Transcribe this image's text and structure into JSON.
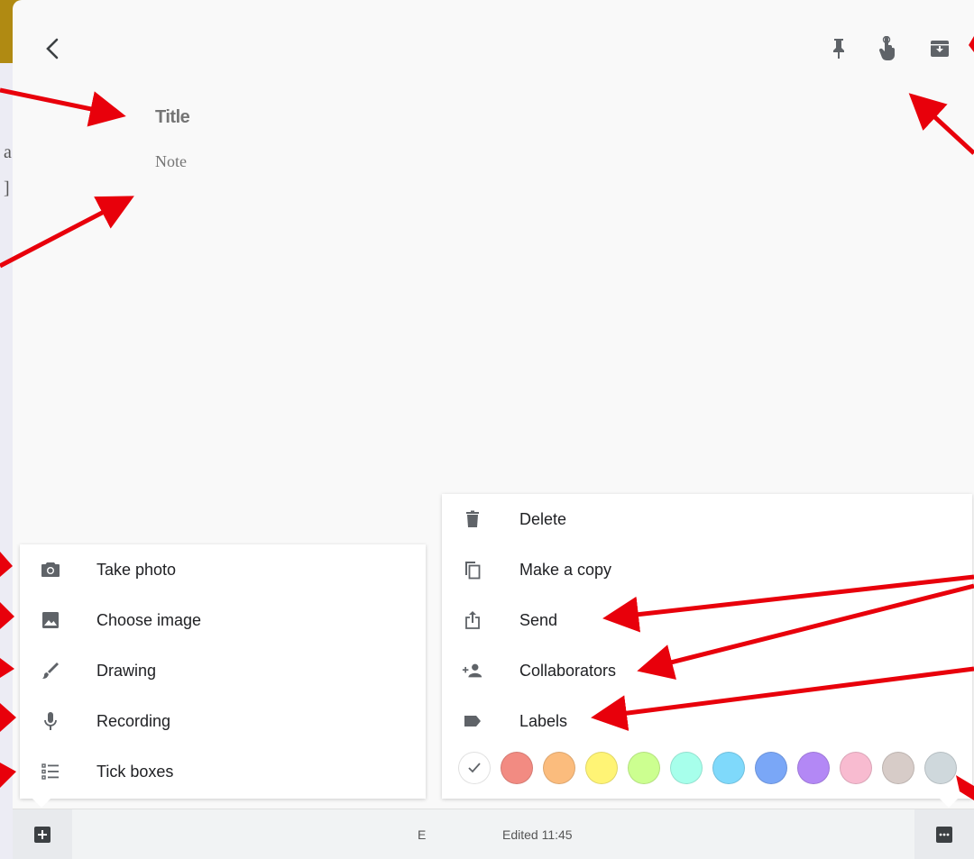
{
  "background": {
    "char_1": "a",
    "char_2": "]"
  },
  "note": {
    "title_placeholder": "Title",
    "note_placeholder": "Note"
  },
  "toolbar": {
    "icons": [
      "pin-icon",
      "reminder-icon",
      "archive-icon"
    ]
  },
  "add_menu": {
    "items": [
      {
        "icon": "camera-icon",
        "label": "Take photo"
      },
      {
        "icon": "image-icon",
        "label": "Choose image"
      },
      {
        "icon": "brush-icon",
        "label": "Drawing"
      },
      {
        "icon": "microphone-icon",
        "label": "Recording"
      },
      {
        "icon": "checklist-icon",
        "label": "Tick boxes"
      }
    ]
  },
  "more_menu": {
    "items": [
      {
        "icon": "trash-icon",
        "label": "Delete"
      },
      {
        "icon": "copy-icon",
        "label": "Make a copy"
      },
      {
        "icon": "share-icon",
        "label": "Send"
      },
      {
        "icon": "add-person-icon",
        "label": "Collaborators"
      },
      {
        "icon": "label-icon",
        "label": "Labels"
      }
    ],
    "colors": [
      "#ffffff",
      "#f28b82",
      "#fbbc7d",
      "#fff475",
      "#ccff90",
      "#a7ffeb",
      "#7fd9fb",
      "#7aa7f7",
      "#b388f5",
      "#f8bbd0",
      "#d7ccc8",
      "#cfd8dc"
    ]
  },
  "bottom_bar": {
    "edited_text": "Edited 11:45",
    "edited_clipped": "E"
  },
  "accent_colors": {
    "annotation_arrow": "#e8000b",
    "icon": "#5f6368"
  }
}
